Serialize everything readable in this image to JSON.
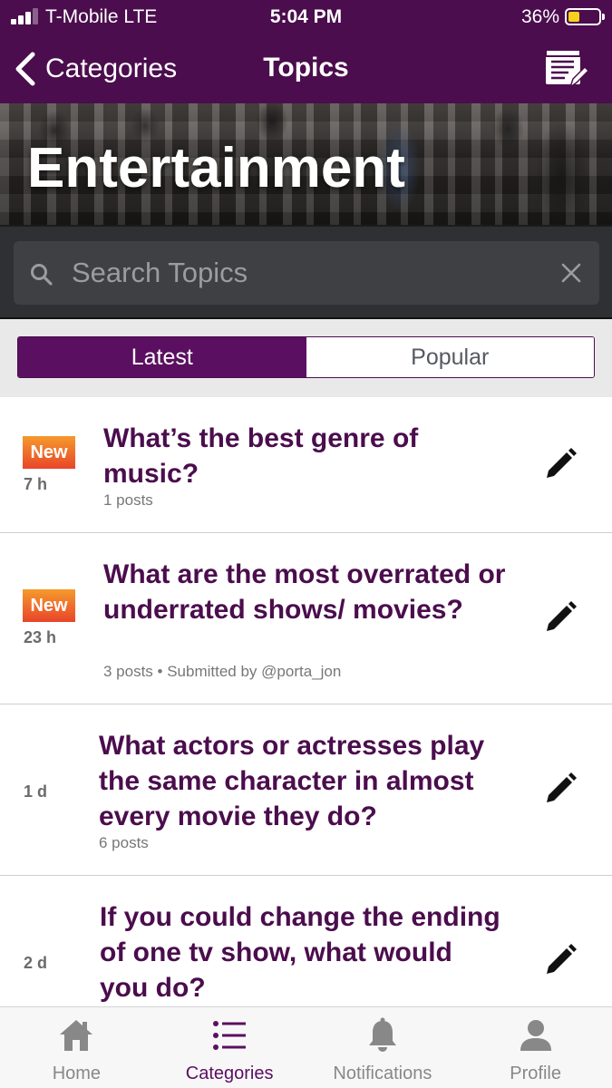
{
  "status_bar": {
    "carrier": "T-Mobile  LTE",
    "time": "5:04 PM",
    "battery_percent": "36%",
    "battery_level": 0.36,
    "signal_bars": 3
  },
  "nav": {
    "back_label": "Categories",
    "title": "Topics",
    "compose_icon": "compose-icon"
  },
  "category": {
    "title": "Entertainment"
  },
  "search": {
    "placeholder": "Search Topics"
  },
  "tabs": {
    "latest": "Latest",
    "popular": "Popular",
    "selected": "Latest"
  },
  "topics": [
    {
      "badge": "New",
      "age": "7 h",
      "title": "What’s the best genre of music?",
      "meta": "1 posts"
    },
    {
      "badge": "New",
      "age": "23 h",
      "title": "What are the most overrated or underrated shows/ movies?",
      "meta": "3 posts • Submitted by @porta_jon"
    },
    {
      "badge": "",
      "age": "1 d",
      "title": "What actors or actresses play the same character in almost every movie they do?",
      "meta": "6 posts"
    },
    {
      "badge": "",
      "age": "2 d",
      "title": "If you could change the ending of one tv show, what would you do?",
      "meta": ""
    }
  ],
  "tab_bar": {
    "home": "Home",
    "categories": "Categories",
    "notifications": "Notifications",
    "profile": "Profile",
    "active": "Categories"
  },
  "colors": {
    "brand": "#4b0d4d",
    "brand_active": "#5b0f60",
    "new_badge": "#e8452a"
  }
}
